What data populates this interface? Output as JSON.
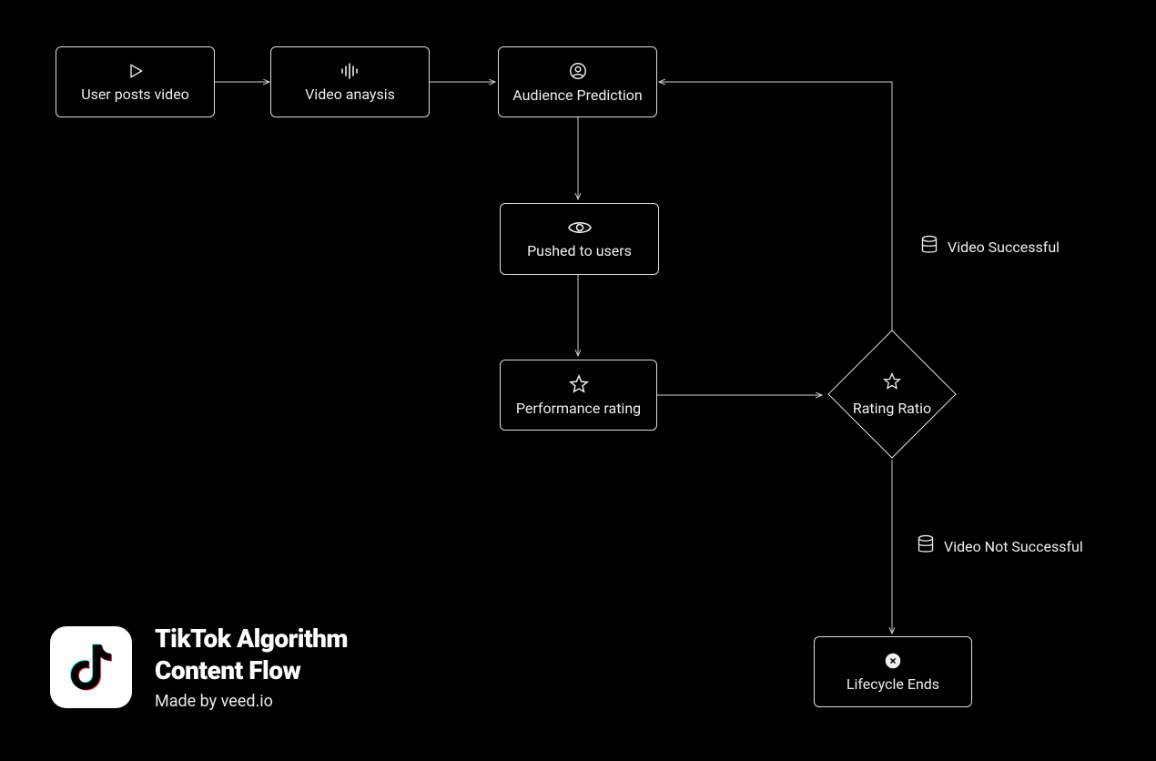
{
  "nodes": {
    "user_posts_video": {
      "label": "User posts video"
    },
    "video_analysis": {
      "label": "Video anaysis"
    },
    "audience_prediction": {
      "label": "Audience Prediction"
    },
    "pushed_to_users": {
      "label": "Pushed to users"
    },
    "performance_rating": {
      "label": "Performance rating"
    },
    "lifecycle_ends": {
      "label": "Lifecycle Ends"
    }
  },
  "decision": {
    "rating_ratio": {
      "label": "Rating Ratio"
    }
  },
  "annotations": {
    "video_successful": {
      "label": "Video Successful"
    },
    "video_not_successful": {
      "label": "Video Not Successful"
    }
  },
  "footer": {
    "title_line1": "TikTok Algorithm",
    "title_line2": "Content Flow",
    "subtitle": "Made by veed.io"
  }
}
